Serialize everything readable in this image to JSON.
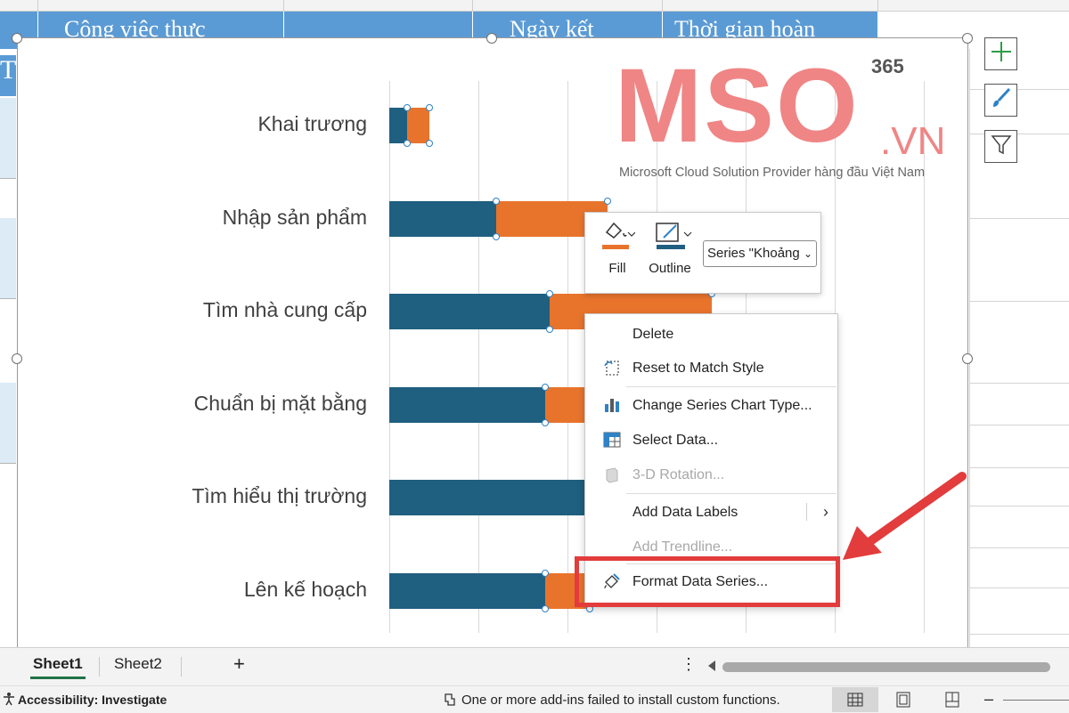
{
  "sheet_header": {
    "cells": [
      "Công việc thực",
      "Ngày kết",
      "Thời gian hoàn"
    ],
    "left_label": "T"
  },
  "chart_data": {
    "type": "bar",
    "orientation": "horizontal-stacked",
    "categories": [
      "Khai trương",
      "Nhập sản phẩm",
      "Tìm nhà cung cấp",
      "Chuẩn bị mặt bằng",
      "Tìm hiểu thị trường",
      "Lên kế hoạch"
    ],
    "series": [
      {
        "values": [
          20,
          120,
          180,
          175,
          290,
          175
        ],
        "color": "#1f5f80"
      },
      {
        "values": [
          25,
          125,
          182,
          50,
          70,
          50
        ],
        "color": "#e8742c"
      }
    ],
    "title": "",
    "xlabel": "",
    "ylabel": "",
    "xlim": [
      0,
      600
    ],
    "grid": true,
    "selected_series": 1
  },
  "watermark": {
    "brand": "MSO",
    "suffix": ".VN",
    "badge": "365",
    "tagline": "Microsoft Cloud Solution Provider hàng đầu Việt Nam"
  },
  "side_buttons": [
    {
      "icon": "plus-icon"
    },
    {
      "icon": "brush-icon"
    },
    {
      "icon": "filter-icon"
    }
  ],
  "mini_toolbar": {
    "fill_label": "Fill",
    "outline_label": "Outline",
    "series_select": "Series \"Khoảng",
    "fill_color": "#e8742c",
    "outline_color": "#1f5f80"
  },
  "context_menu": {
    "items": [
      {
        "label": "Delete",
        "icon": "",
        "enabled": true
      },
      {
        "label": "Reset to Match Style",
        "icon": "reset-style-icon",
        "enabled": true
      },
      {
        "label": "Change Series Chart Type...",
        "icon": "chart-type-icon",
        "enabled": true
      },
      {
        "label": "Select Data...",
        "icon": "select-data-icon",
        "enabled": true
      },
      {
        "label": "3-D Rotation...",
        "icon": "rotation-3d-icon",
        "enabled": false
      },
      {
        "label": "Add Data Labels",
        "icon": "",
        "enabled": true,
        "submenu": true
      },
      {
        "label": "Add Trendline...",
        "icon": "",
        "enabled": false
      },
      {
        "label": "Format Data Series...",
        "icon": "format-series-icon",
        "enabled": true,
        "highlighted": true
      }
    ],
    "highlight_color": "#e23c3c"
  },
  "sheet_tabs": {
    "tabs": [
      "Sheet1",
      "Sheet2"
    ],
    "active": "Sheet1",
    "add": "+",
    "more": "⋮"
  },
  "status_bar": {
    "accessibility": "Accessibility: Investigate",
    "message": "One or more add-ins failed to install custom functions.",
    "zoom_minus": "–"
  }
}
